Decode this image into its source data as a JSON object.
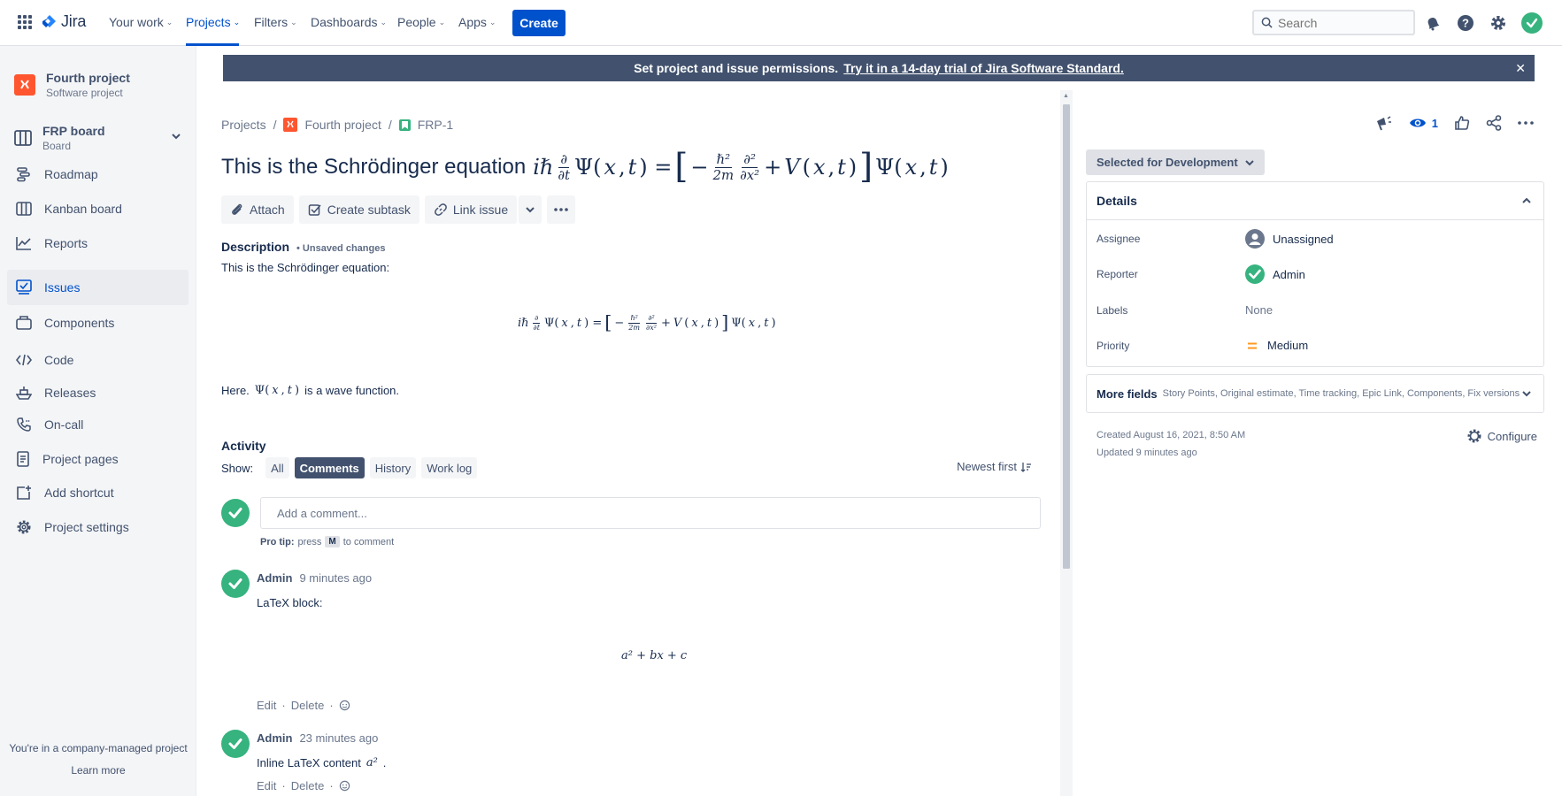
{
  "topnav": {
    "logo": "Jira",
    "items": [
      {
        "label": "Your work"
      },
      {
        "label": "Projects"
      },
      {
        "label": "Filters"
      },
      {
        "label": "Dashboards"
      },
      {
        "label": "People"
      },
      {
        "label": "Apps"
      }
    ],
    "create_label": "Create",
    "search_placeholder": "Search"
  },
  "sidebar": {
    "project_name": "Fourth project",
    "project_type": "Software project",
    "board_name": "FRP board",
    "board_sub": "Board",
    "items": [
      {
        "label": "Roadmap"
      },
      {
        "label": "Kanban board"
      },
      {
        "label": "Reports"
      },
      {
        "label": "Issues"
      },
      {
        "label": "Components"
      },
      {
        "label": "Code"
      },
      {
        "label": "Releases"
      },
      {
        "label": "On-call"
      },
      {
        "label": "Project pages"
      },
      {
        "label": "Add shortcut"
      },
      {
        "label": "Project settings"
      }
    ],
    "footer_text": "You're in a company-managed project",
    "footer_link": "Learn more"
  },
  "banner": {
    "text": "Set project and issue permissions.",
    "link": "Try it in a 14-day trial of Jira Software Standard."
  },
  "issue": {
    "breadcrumb": [
      "Projects",
      "Fourth project",
      "FRP-1"
    ],
    "title_text": "This is the Schrödinger equation",
    "toolbar": {
      "attach": "Attach",
      "create_subtask": "Create subtask",
      "link_issue": "Link issue"
    },
    "description_label": "Description",
    "unsaved": "• Unsaved changes",
    "description_intro": "This is the Schrödinger equation:",
    "here_prefix": "Here.",
    "here_suffix": "is a wave function.",
    "activity": {
      "title": "Activity",
      "show_label": "Show:",
      "filters": [
        "All",
        "Comments",
        "History",
        "Work log"
      ],
      "active_filter": "Comments",
      "sort": "Newest first",
      "add_placeholder": "Add a comment...",
      "protip_label": "Pro tip:",
      "protip_press": "press",
      "protip_key": "M",
      "protip_suffix": "to comment",
      "comments": [
        {
          "author": "Admin",
          "time": "9 minutes ago",
          "body": "LaTeX block:",
          "formula": "a² + bx + c"
        },
        {
          "author": "Admin",
          "time": "23 minutes ago",
          "body": "Inline LaTeX content"
        }
      ],
      "edit": "Edit",
      "delete": "Delete"
    }
  },
  "right": {
    "watchers": "1",
    "status": "Selected for Development",
    "details_title": "Details",
    "fields": [
      {
        "label": "Assignee",
        "value": "Unassigned"
      },
      {
        "label": "Reporter",
        "value": "Admin"
      },
      {
        "label": "Labels",
        "value": "None"
      },
      {
        "label": "Priority",
        "value": "Medium"
      }
    ],
    "more_fields_title": "More fields",
    "more_fields_sub": "Story Points, Original estimate, Time tracking, Epic Link, Components, Fix versions",
    "created": "Created August 16, 2021, 8:50 AM",
    "updated": "Updated 9 minutes ago",
    "configure": "Configure"
  },
  "colors": {
    "brand": "#0052cc",
    "success": "#36b37e",
    "banner": "#42526e",
    "priority": "#ff991f"
  }
}
